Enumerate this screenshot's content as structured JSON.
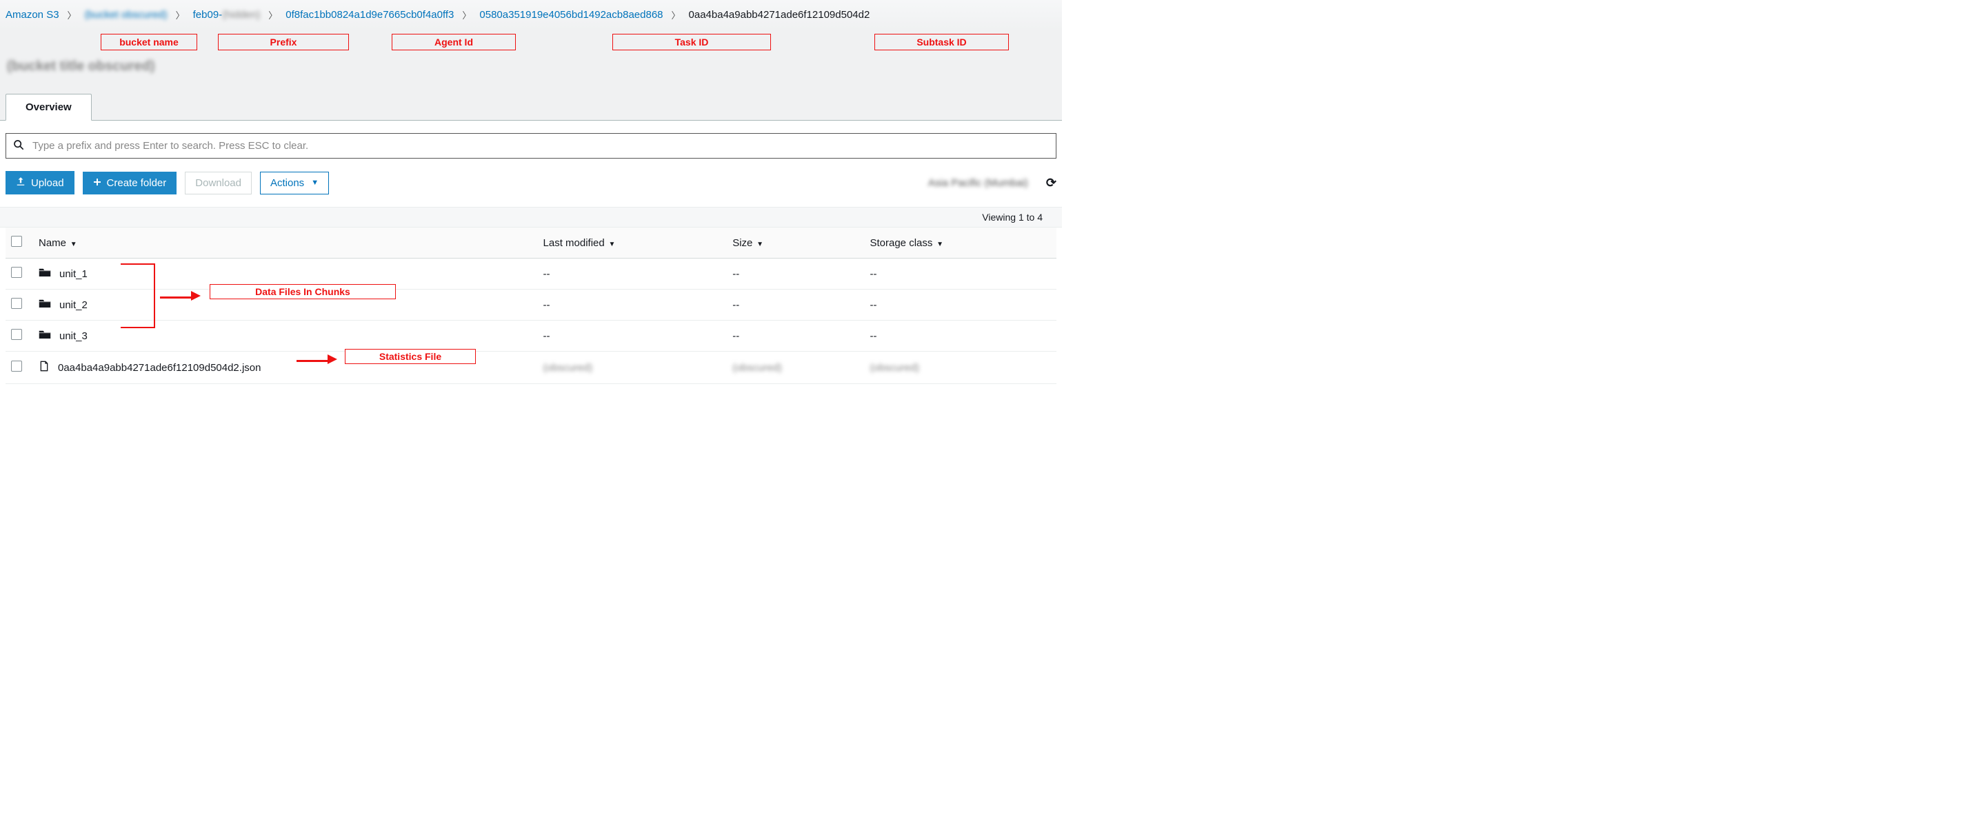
{
  "breadcrumb": {
    "root": "Amazon S3",
    "bucket": "(bucket obscured)",
    "prefix_partial": "feb09-",
    "prefix_obscured": "(hidden)",
    "agent_id": "0f8fac1bb0824a1d9e7665cb0f4a0ff3",
    "task_id": "0580a351919e4056bd1492acb8aed868",
    "subtask_id": "0aa4ba4a9abb4271ade6f12109d504d2"
  },
  "annotations": {
    "bucket": "bucket name",
    "prefix": "Prefix",
    "agent": "Agent Id",
    "task": "Task ID",
    "subtask": "Subtask ID",
    "chunks": "Data Files In Chunks",
    "stats": "Statistics File"
  },
  "page_title": "(bucket title obscured)",
  "tabs": {
    "overview": "Overview"
  },
  "search": {
    "placeholder": "Type a prefix and press Enter to search. Press ESC to clear."
  },
  "buttons": {
    "upload": "Upload",
    "create_folder": "Create folder",
    "download": "Download",
    "actions": "Actions"
  },
  "region": "Asia Pacific (Mumbai)",
  "viewing": "Viewing 1 to 4",
  "columns": {
    "name": "Name",
    "last_modified": "Last modified",
    "size": "Size",
    "storage_class": "Storage class"
  },
  "rows": [
    {
      "type": "folder",
      "name": "unit_1",
      "last_modified": "--",
      "size": "--",
      "storage_class": "--"
    },
    {
      "type": "folder",
      "name": "unit_2",
      "last_modified": "--",
      "size": "--",
      "storage_class": "--"
    },
    {
      "type": "folder",
      "name": "unit_3",
      "last_modified": "--",
      "size": "--",
      "storage_class": "--"
    },
    {
      "type": "file",
      "name": "0aa4ba4a9abb4271ade6f12109d504d2.json",
      "last_modified": "(obscured)",
      "size": "(obscured)",
      "storage_class": "(obscured)"
    }
  ]
}
